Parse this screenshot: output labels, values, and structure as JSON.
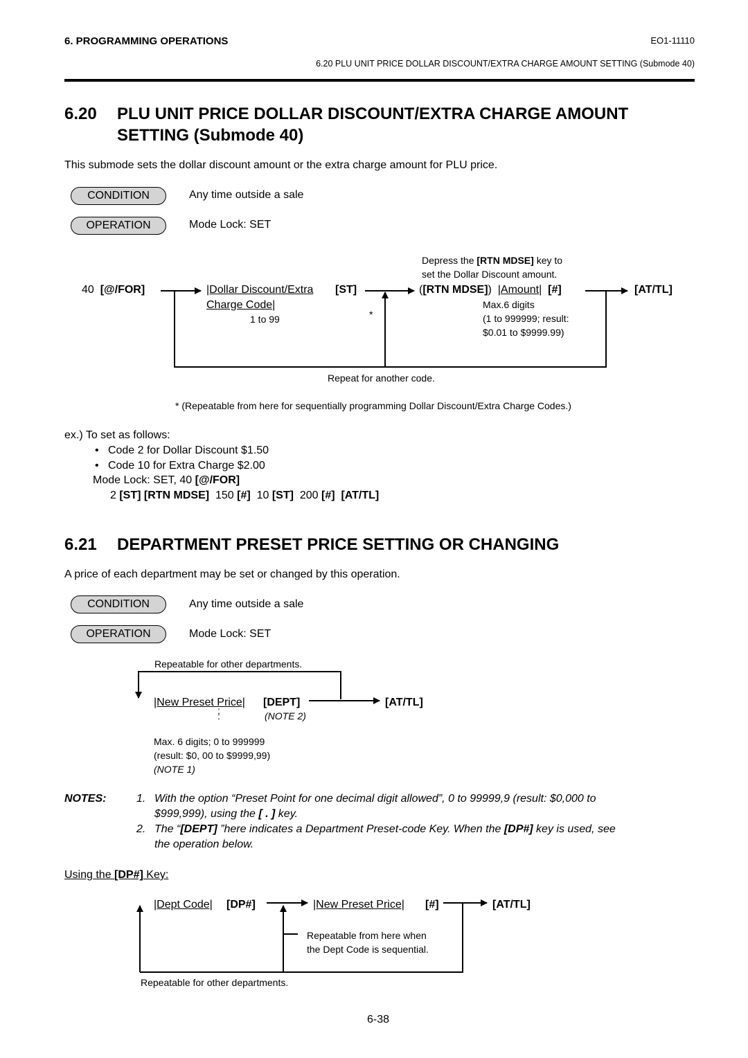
{
  "header": {
    "chapter": "6.  PROGRAMMING OPERATIONS",
    "doc_number": "EO1-11110",
    "subheader": "6.20  PLU UNIT PRICE DOLLAR DISCOUNT/EXTRA CHARGE AMOUNT SETTING  (Submode 40)"
  },
  "section620": {
    "number": "6.20",
    "title_line1": "PLU UNIT PRICE DOLLAR DISCOUNT/EXTRA CHARGE AMOUNT",
    "title_line2": "SETTING  (Submode 40)",
    "intro": "This submode sets the dollar discount amount or the extra charge amount for PLU price.",
    "condition_label": "CONDITION",
    "condition_text": "Any time outside a sale",
    "operation_label": "OPERATION",
    "operation_text": "Mode Lock:  SET",
    "flow": {
      "start_num": "40",
      "start_key": "[@/FOR]",
      "code_line1": "|Dollar Discount/Extra",
      "code_line2": "Charge Code|",
      "code_range": "1 to 99",
      "st_key": "[ST]",
      "asterisk": "*",
      "note_line1_pre": "Depress the ",
      "note_line1_key": "[RTN MDSE]",
      "note_line1_post": " key to",
      "note_line2": "set the Dollar Discount amount.",
      "rtn_open": "(",
      "rtn_key": "[RTN MDSE]",
      "rtn_close": ")",
      "amount": "|Amount|",
      "hash_key": "[#]",
      "amount_max": "Max.6 digits",
      "amount_range1": "(1 to 999999;  result:",
      "amount_range2": "$0.01 to $9999.99)",
      "end_key": "[AT/TL]",
      "repeat_label": "Repeat for another code."
    },
    "footnote": "*  (Repeatable from here for sequentially programming Dollar Discount/Extra Charge Codes.)",
    "example": {
      "lead": "ex.)  To set as follows:",
      "bullets": [
        "Code 2 for Dollar Discount $1.50",
        "Code 10 for Extra Charge $2.00"
      ],
      "mode_line_text": "Mode Lock:  SET, 40 ",
      "mode_line_key": "[@/FOR]",
      "seq": [
        "2 ",
        "[ST] [RTN MDSE]",
        "  150 ",
        "[#]",
        "  10 ",
        "[ST]",
        "  200 ",
        "[#]",
        "  ",
        "[AT/TL]"
      ]
    }
  },
  "section621": {
    "number": "6.21",
    "title": "DEPARTMENT PRESET PRICE SETTING OR CHANGING",
    "intro": "A price of each department may be set or changed by this operation.",
    "condition_label": "CONDITION",
    "condition_text": "Any time outside a sale",
    "operation_label": "OPERATION",
    "operation_text": "Mode Lock:  SET",
    "flow": {
      "repeat_label": "Repeatable for other departments.",
      "price": "|New Preset Price|",
      "dept_key": "[DEPT]",
      "note2": "(NOTE 2)",
      "end_key": "[AT/TL]",
      "max_line": "Max. 6 digits;  0 to 999999",
      "result_line": "(result:  $0, 00 to $9999,99)",
      "note1": "(NOTE 1)"
    },
    "notes": {
      "label": "NOTES:",
      "n1_num": "1.",
      "n1_line1": "With the option “Preset Point for one decimal digit allowed”, 0 to 99999,9 (result:  $0,000 to",
      "n1_line2_pre": "$999,999), using the ",
      "n1_line2_key": "[ . ]",
      "n1_line2_post": " key.",
      "n2_num": "2.",
      "n2_line1_pre": "The “",
      "n2_line1_key": "[DEPT]",
      "n2_line1_mid": " ”here indicates a Department Preset-code Key. When the ",
      "n2_line1_key2": "[DP#]",
      "n2_line1_post": " key is used, see",
      "n2_line2": "the operation below."
    },
    "dp": {
      "heading_pre": "Using the ",
      "heading_key": "[DP#]",
      "heading_post": " Key:",
      "dept_code": "|Dept Code|",
      "dp_key": "[DP#]",
      "price": "|New Preset Price|",
      "hash_key": "[#]",
      "end_key": "[AT/TL]",
      "seq_note1": "Repeatable from here when",
      "seq_note2": "the Dept Code is sequential.",
      "repeat_label": "Repeatable for other departments."
    }
  },
  "page_number": "6-38"
}
